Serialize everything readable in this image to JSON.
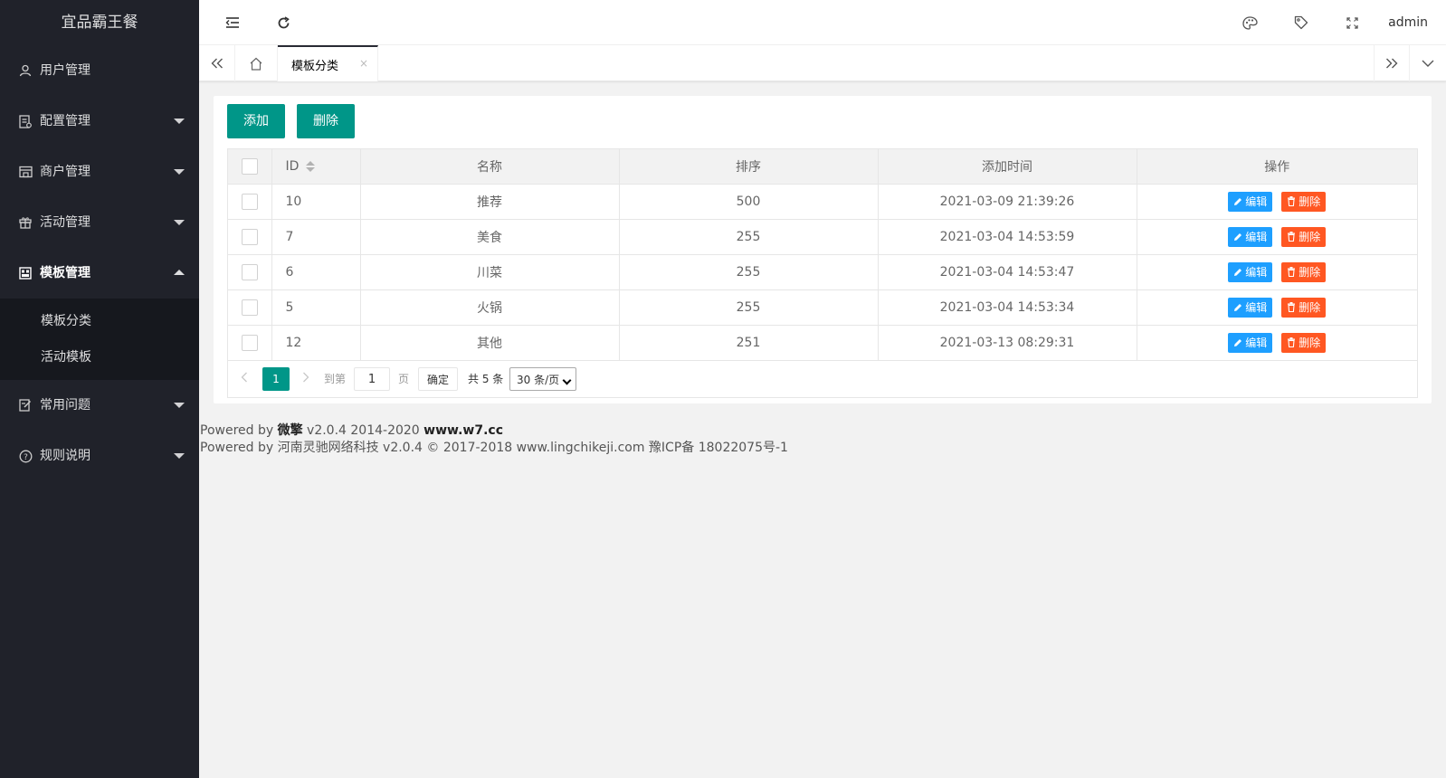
{
  "sidebar": {
    "logo": "宜品霸王餐",
    "items": [
      {
        "label": "用户管理",
        "icon": "user-icon"
      },
      {
        "label": "配置管理",
        "icon": "config-icon"
      },
      {
        "label": "商户管理",
        "icon": "store-icon"
      },
      {
        "label": "活动管理",
        "icon": "gift-icon"
      },
      {
        "label": "模板管理",
        "icon": "template-icon"
      },
      {
        "label": "常用问题",
        "icon": "faq-icon"
      },
      {
        "label": "规则说明",
        "icon": "help-icon"
      }
    ],
    "subitems": [
      "模板分类",
      "活动模板"
    ]
  },
  "header": {
    "user": "admin",
    "icons": [
      "menu-fold-icon",
      "refresh-icon",
      "theme-icon",
      "tag-icon",
      "fullscreen-icon"
    ]
  },
  "tabs": {
    "active_label": "模板分类",
    "close_glyph": "×"
  },
  "toolbar": {
    "add_label": "添加",
    "delete_label": "删除"
  },
  "table": {
    "columns": [
      "ID",
      "名称",
      "排序",
      "添加时间",
      "操作"
    ],
    "rows": [
      {
        "id": "10",
        "name": "推荐",
        "sort": "500",
        "time": "2021-03-09 21:39:26"
      },
      {
        "id": "7",
        "name": "美食",
        "sort": "255",
        "time": "2021-03-04 14:53:59"
      },
      {
        "id": "6",
        "name": "川菜",
        "sort": "255",
        "time": "2021-03-04 14:53:47"
      },
      {
        "id": "5",
        "name": "火锅",
        "sort": "255",
        "time": "2021-03-04 14:53:34"
      },
      {
        "id": "12",
        "name": "其他",
        "sort": "251",
        "time": "2021-03-13 08:29:31"
      }
    ],
    "edit_label": "编辑",
    "delete_label": "删除"
  },
  "pager": {
    "current": "1",
    "goto_label": "到第",
    "goto_value": "1",
    "page_label": "页",
    "confirm_label": "确定",
    "total_label": "共 5 条",
    "per_page": "30 条/页"
  },
  "footer": {
    "line1_prefix": "Powered by ",
    "line1_brand": "微擎",
    "line1_version": " v2.0.4 2014-2020 ",
    "line1_site": "www.w7.cc",
    "line2": "Powered by 河南灵驰网络科技 v2.0.4 © 2017-2018 www.lingchikeji.com 豫ICP备 18022075号-1"
  },
  "colors": {
    "sidebar_bg": "#20222a",
    "primary": "#009688",
    "edit": "#1e9fff",
    "danger": "#ff5722"
  }
}
